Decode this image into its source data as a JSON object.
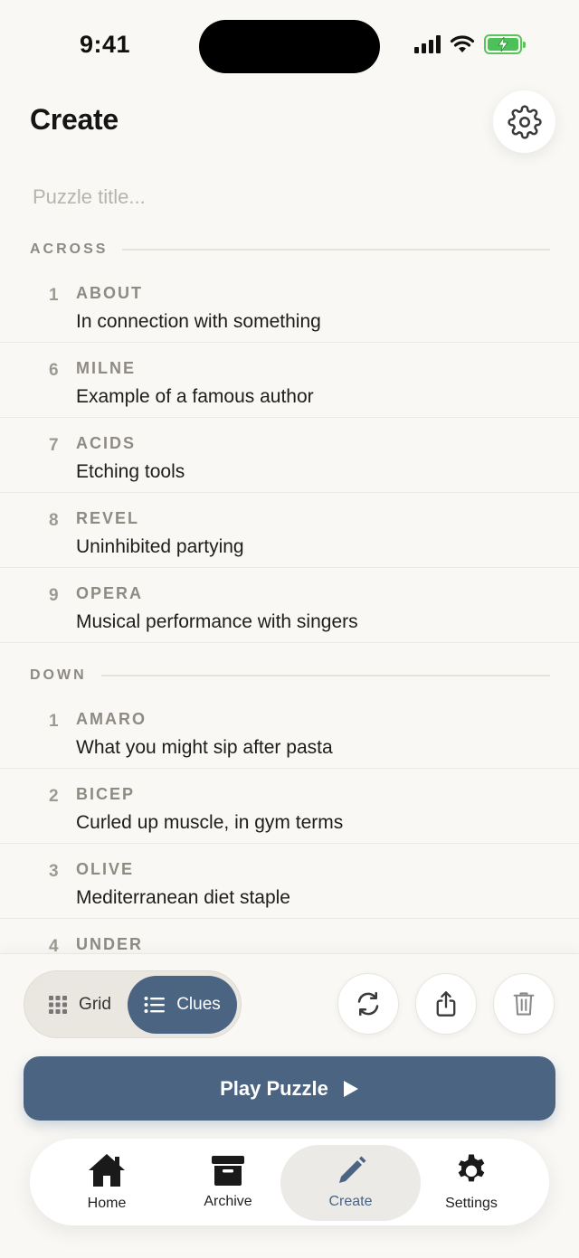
{
  "status_bar": {
    "time": "9:41"
  },
  "header": {
    "title": "Create"
  },
  "title_input": {
    "placeholder": "Puzzle title...",
    "value": ""
  },
  "sections": {
    "across": {
      "label": "ACROSS",
      "clues": [
        {
          "number": "1",
          "answer": "ABOUT",
          "clue": "In connection with something"
        },
        {
          "number": "6",
          "answer": "MILNE",
          "clue": "Example of a famous author"
        },
        {
          "number": "7",
          "answer": "ACIDS",
          "clue": "Etching tools"
        },
        {
          "number": "8",
          "answer": "REVEL",
          "clue": "Uninhibited partying"
        },
        {
          "number": "9",
          "answer": "OPERA",
          "clue": "Musical performance with singers"
        }
      ]
    },
    "down": {
      "label": "DOWN",
      "clues": [
        {
          "number": "1",
          "answer": "AMARO",
          "clue": "What you might sip after pasta"
        },
        {
          "number": "2",
          "answer": "BICEP",
          "clue": "Curled up muscle, in gym terms"
        },
        {
          "number": "3",
          "answer": "OLIVE",
          "clue": "Mediterranean diet staple"
        },
        {
          "number": "4",
          "answer": "UNDER",
          "clue": ""
        }
      ]
    }
  },
  "view_toggle": {
    "grid_label": "Grid",
    "clues_label": "Clues",
    "selected": "Clues"
  },
  "actions": {
    "play_label": "Play Puzzle"
  },
  "tab_bar": {
    "items": [
      {
        "label": "Home",
        "icon": "home-icon"
      },
      {
        "label": "Archive",
        "icon": "archive-icon"
      },
      {
        "label": "Create",
        "icon": "pencil-icon"
      },
      {
        "label": "Settings",
        "icon": "gear-icon"
      }
    ],
    "active": "Create"
  },
  "colors": {
    "background": "#f9f8f5",
    "accent": "#4a6482",
    "muted_text": "#8e8b82",
    "battery_green": "#4cc158"
  }
}
